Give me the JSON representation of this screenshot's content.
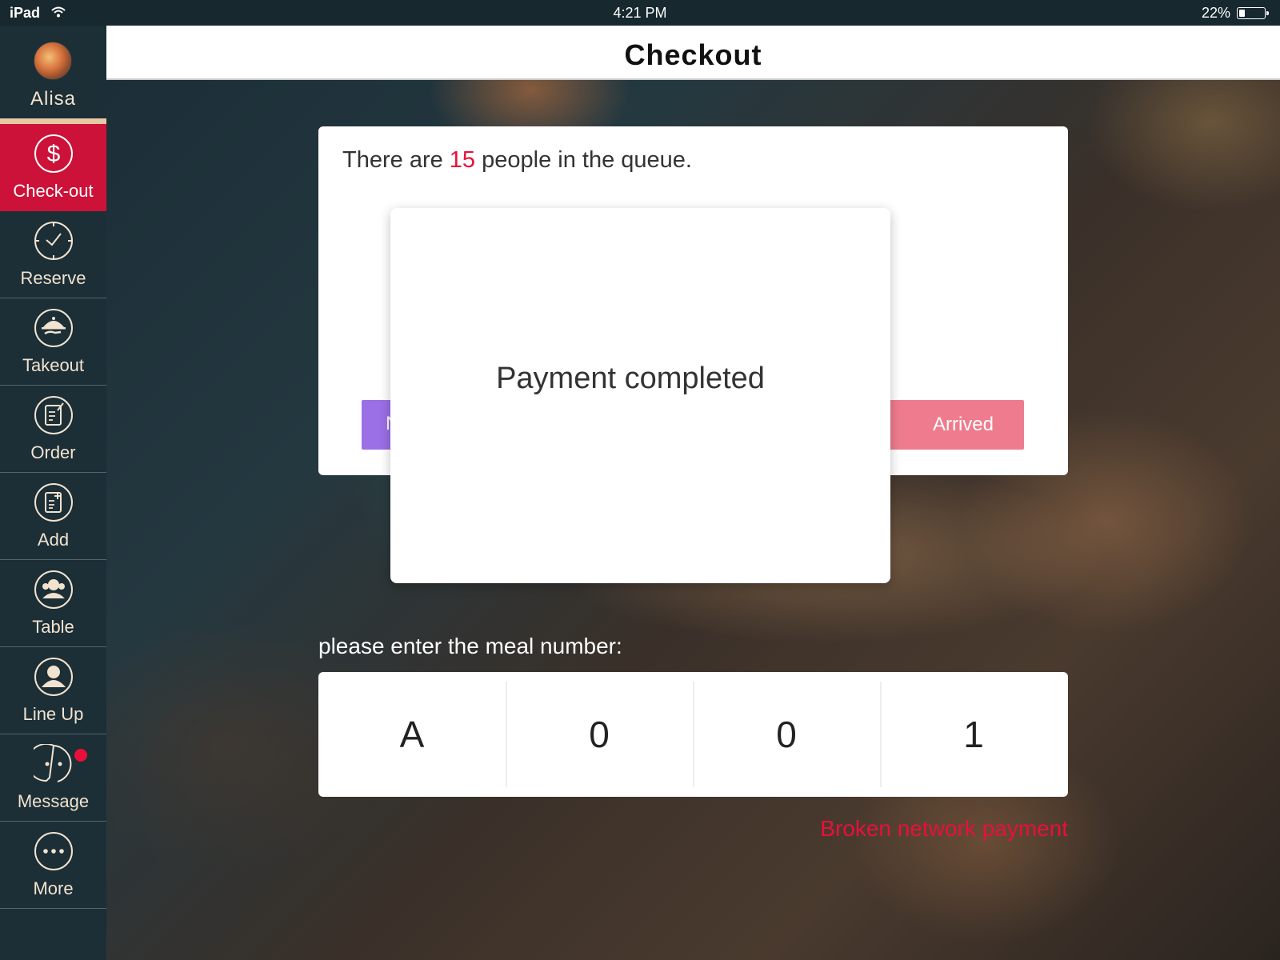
{
  "status_bar": {
    "device": "iPad",
    "time": "4:21 PM",
    "battery": "22%",
    "battery_level": 0.22
  },
  "profile": {
    "name": "Alisa"
  },
  "sidebar": {
    "items": [
      {
        "label": "Check-out",
        "icon": "dollar-icon",
        "active": true
      },
      {
        "label": "Reserve",
        "icon": "clock-icon"
      },
      {
        "label": "Takeout",
        "icon": "cloche-icon"
      },
      {
        "label": "Order",
        "icon": "note-icon"
      },
      {
        "label": "Add",
        "icon": "add-document-icon"
      },
      {
        "label": "Table",
        "icon": "people-icon"
      },
      {
        "label": "Line Up",
        "icon": "person-icon"
      },
      {
        "label": "Message",
        "icon": "chat-icon",
        "unread": true
      },
      {
        "label": "More",
        "icon": "more-icon"
      }
    ]
  },
  "header": {
    "title": "Checkout"
  },
  "queue": {
    "prefix": "There are ",
    "count": "15",
    "suffix": " people in the queue.",
    "left_button": "N",
    "arrived_button": "Arrived"
  },
  "modal": {
    "message": "Payment completed"
  },
  "meal": {
    "label": "please enter the meal number:",
    "digits": [
      "A",
      "0",
      "0",
      "1"
    ]
  },
  "broken_network": "Broken network payment",
  "colors": {
    "accent": "#cc1238",
    "alert": "#e8103a",
    "sidebar": "#1c2e36",
    "arrived": "#ee7c8e",
    "purple": "#9b6fe6"
  }
}
